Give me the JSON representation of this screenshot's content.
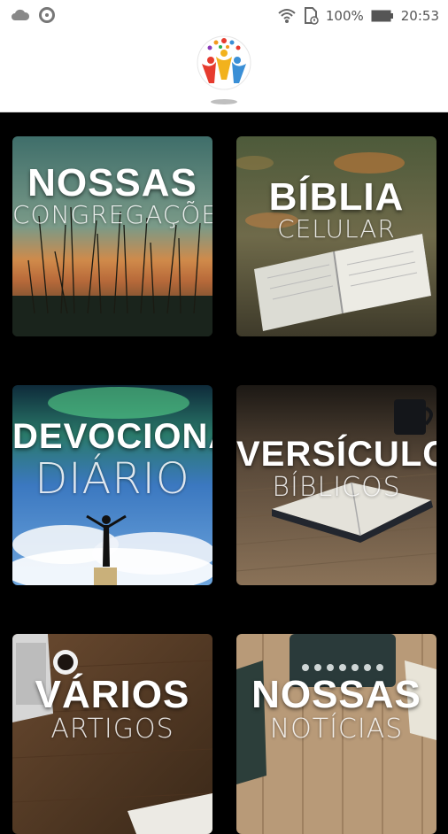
{
  "status_bar": {
    "left_icons": [
      "cloud-icon",
      "ring-icon"
    ],
    "right_icons": [
      "wifi-icon",
      "sim-icon",
      "battery-icon"
    ],
    "battery_percent": "100%",
    "time": "20:53"
  },
  "header": {
    "logo_icon": "church-people-logo-icon"
  },
  "tiles": [
    {
      "title": "NOSSAS",
      "subtitle": "CONGREGAÇÕES"
    },
    {
      "title": "BÍBLIA",
      "subtitle": "CELULAR"
    },
    {
      "title": "DEVOCIONAL",
      "subtitle": "DIÁRIO"
    },
    {
      "title": "VERSÍCULOS",
      "subtitle": "BÍBLICOS"
    },
    {
      "title": "VÁRIOS",
      "subtitle": "ARTIGOS"
    },
    {
      "title": "NOSSAS",
      "subtitle": "NOTÍCIAS"
    }
  ]
}
